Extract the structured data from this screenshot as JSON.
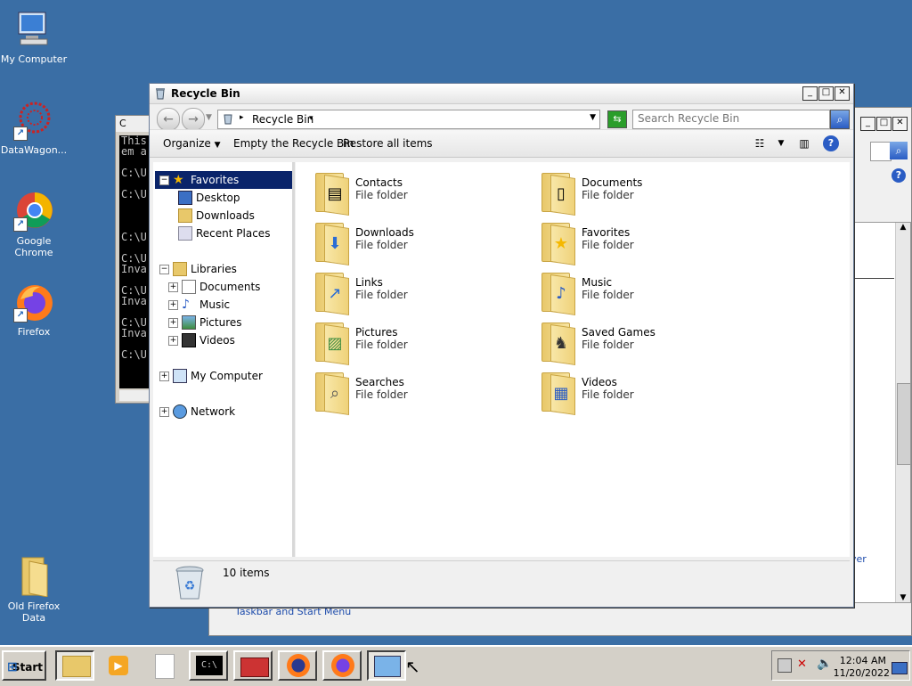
{
  "desktop": {
    "icons": [
      {
        "label": "My Computer"
      },
      {
        "label": "DataWagon..."
      },
      {
        "label": "Google Chrome"
      },
      {
        "label": "Firefox"
      },
      {
        "label": "Old Firefox Data"
      }
    ]
  },
  "cmd": {
    "title_fragment": "C",
    "lines": "This\nem a\n\nC:\\U\n\nC:\\U\n\n\n\nC:\\U\n\nC:\\U\nInva\n\nC:\\U\nInva\n\nC:\\U\nInva\n\nC:\\U"
  },
  "bg_window": {
    "link_taskbar": "Taskbar and Start Menu",
    "link_fragment": "ver"
  },
  "window": {
    "title": "Recycle Bin",
    "address": "Recycle Bin",
    "search_placeholder": "Search Recycle Bin",
    "controls": {
      "minimize": "_",
      "maximize": "□",
      "close": "✕"
    }
  },
  "toolbar": {
    "organize": "Organize",
    "empty": "Empty the Recycle Bin",
    "restore": "Restore all items"
  },
  "nav": {
    "favorites": "Favorites",
    "desktop": "Desktop",
    "downloads": "Downloads",
    "recent": "Recent Places",
    "libraries": "Libraries",
    "documents": "Documents",
    "music": "Music",
    "pictures": "Pictures",
    "videos": "Videos",
    "my_computer": "My Computer",
    "network": "Network"
  },
  "items": [
    {
      "name": "Contacts",
      "type": "File folder",
      "icon": "contact-card-icon"
    },
    {
      "name": "Documents",
      "type": "File folder",
      "icon": "document-icon"
    },
    {
      "name": "Downloads",
      "type": "File folder",
      "icon": "download-arrow-icon"
    },
    {
      "name": "Favorites",
      "type": "File folder",
      "icon": "star-icon"
    },
    {
      "name": "Links",
      "type": "File folder",
      "icon": "link-arrow-icon"
    },
    {
      "name": "Music",
      "type": "File folder",
      "icon": "music-note-icon"
    },
    {
      "name": "Pictures",
      "type": "File folder",
      "icon": "picture-icon"
    },
    {
      "name": "Saved Games",
      "type": "File folder",
      "icon": "chess-piece-icon"
    },
    {
      "name": "Searches",
      "type": "File folder",
      "icon": "magnifier-icon"
    },
    {
      "name": "Videos",
      "type": "File folder",
      "icon": "film-icon"
    }
  ],
  "status": {
    "count": "10 items"
  },
  "taskbar": {
    "start": "Start",
    "time": "12:04 AM",
    "date": "11/20/2022"
  }
}
